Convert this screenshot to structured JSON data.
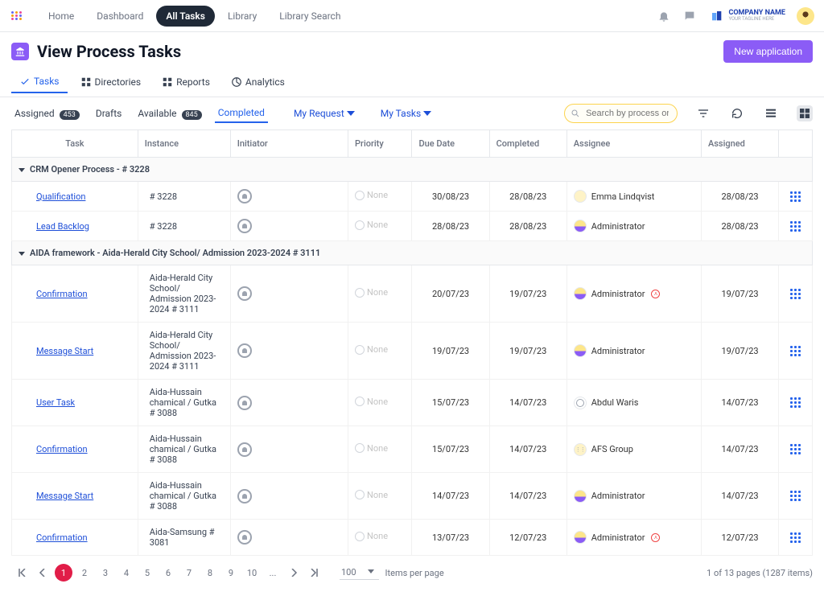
{
  "nav": {
    "home": "Home",
    "dashboard": "Dashboard",
    "allTasks": "All Tasks",
    "library": "Library",
    "librarySearch": "Library Search"
  },
  "company": {
    "name": "COMPANY NAME",
    "tagline": "YOUR TAGLINE HERE"
  },
  "page": {
    "title": "View Process Tasks",
    "newApplication": "New application"
  },
  "subnav": {
    "tasks": "Tasks",
    "directories": "Directories",
    "reports": "Reports",
    "analytics": "Analytics"
  },
  "filters": {
    "assigned": "Assigned",
    "assigned_count": "453",
    "drafts": "Drafts",
    "available": "Available",
    "available_count": "845",
    "completed": "Completed",
    "myRequest": "My Request",
    "myTasks": "My Tasks",
    "searchPlaceholder": "Search by process or tasks"
  },
  "columns": {
    "task": "Task",
    "instance": "Instance",
    "initiator": "Initiator",
    "priority": "Priority",
    "dueDate": "Due Date",
    "completed": "Completed",
    "assignee": "Assignee",
    "assigned": "Assigned"
  },
  "groups": [
    {
      "title": "CRM Opener Process - # 3228",
      "rows": [
        {
          "task": "Qualification",
          "instance": "# 3228",
          "priority": "None",
          "due": "30/08/23",
          "completed": "28/08/23",
          "assignee": "Emma Lindqvist",
          "assigneeType": "user",
          "assigned": "28/08/23"
        },
        {
          "task": "Lead Backlog",
          "instance": "# 3228",
          "priority": "None",
          "due": "28/08/23",
          "completed": "28/08/23",
          "assignee": "Administrator",
          "assigneeType": "admin",
          "assigned": "28/08/23"
        }
      ]
    },
    {
      "title": "AIDA framework - Aida-Herald City School/ Admission 2023-2024 # 3111",
      "rows": [
        {
          "task": "Confirmation",
          "instance": "Aida-Herald City School/ Admission 2023-2024 # 3111",
          "priority": "None",
          "due": "20/07/23",
          "completed": "19/07/23",
          "assignee": "Administrator",
          "assigneeType": "admin",
          "badge": true,
          "assigned": "19/07/23"
        },
        {
          "task": "Message Start",
          "instance": "Aida-Herald City School/ Admission 2023-2024 # 3111",
          "priority": "None",
          "due": "19/07/23",
          "completed": "19/07/23",
          "assignee": "Administrator",
          "assigneeType": "admin",
          "assigned": "19/07/23"
        },
        {
          "task": "User Task",
          "instance": "Aida-Hussain chamical / Gutka # 3088",
          "priority": "None",
          "due": "15/07/23",
          "completed": "14/07/23",
          "assignee": "Abdul Waris",
          "assigneeType": "generic",
          "assigned": "14/07/23"
        },
        {
          "task": "Confirmation",
          "instance": "Aida-Hussain chamical / Gutka # 3088",
          "priority": "None",
          "due": "15/07/23",
          "completed": "14/07/23",
          "assignee": "AFS Group",
          "assigneeType": "group",
          "assigned": "14/07/23"
        },
        {
          "task": "Message Start",
          "instance": "Aida-Hussain chamical / Gutka # 3088",
          "priority": "None",
          "due": "14/07/23",
          "completed": "14/07/23",
          "assignee": "Administrator",
          "assigneeType": "admin",
          "assigned": "14/07/23"
        },
        {
          "task": "Confirmation",
          "instance": "Aida-Samsung # 3081",
          "priority": "None",
          "due": "13/07/23",
          "completed": "12/07/23",
          "assignee": "Administrator",
          "assigneeType": "admin",
          "badge": true,
          "assigned": "12/07/23"
        }
      ]
    }
  ],
  "pager": {
    "pages": [
      "1",
      "2",
      "3",
      "4",
      "5",
      "6",
      "7",
      "8",
      "9",
      "10",
      "..."
    ],
    "current": "1",
    "perPage": "100",
    "perPageLabel": "Items per page",
    "summary": "1 of 13 pages (1287 items)"
  }
}
